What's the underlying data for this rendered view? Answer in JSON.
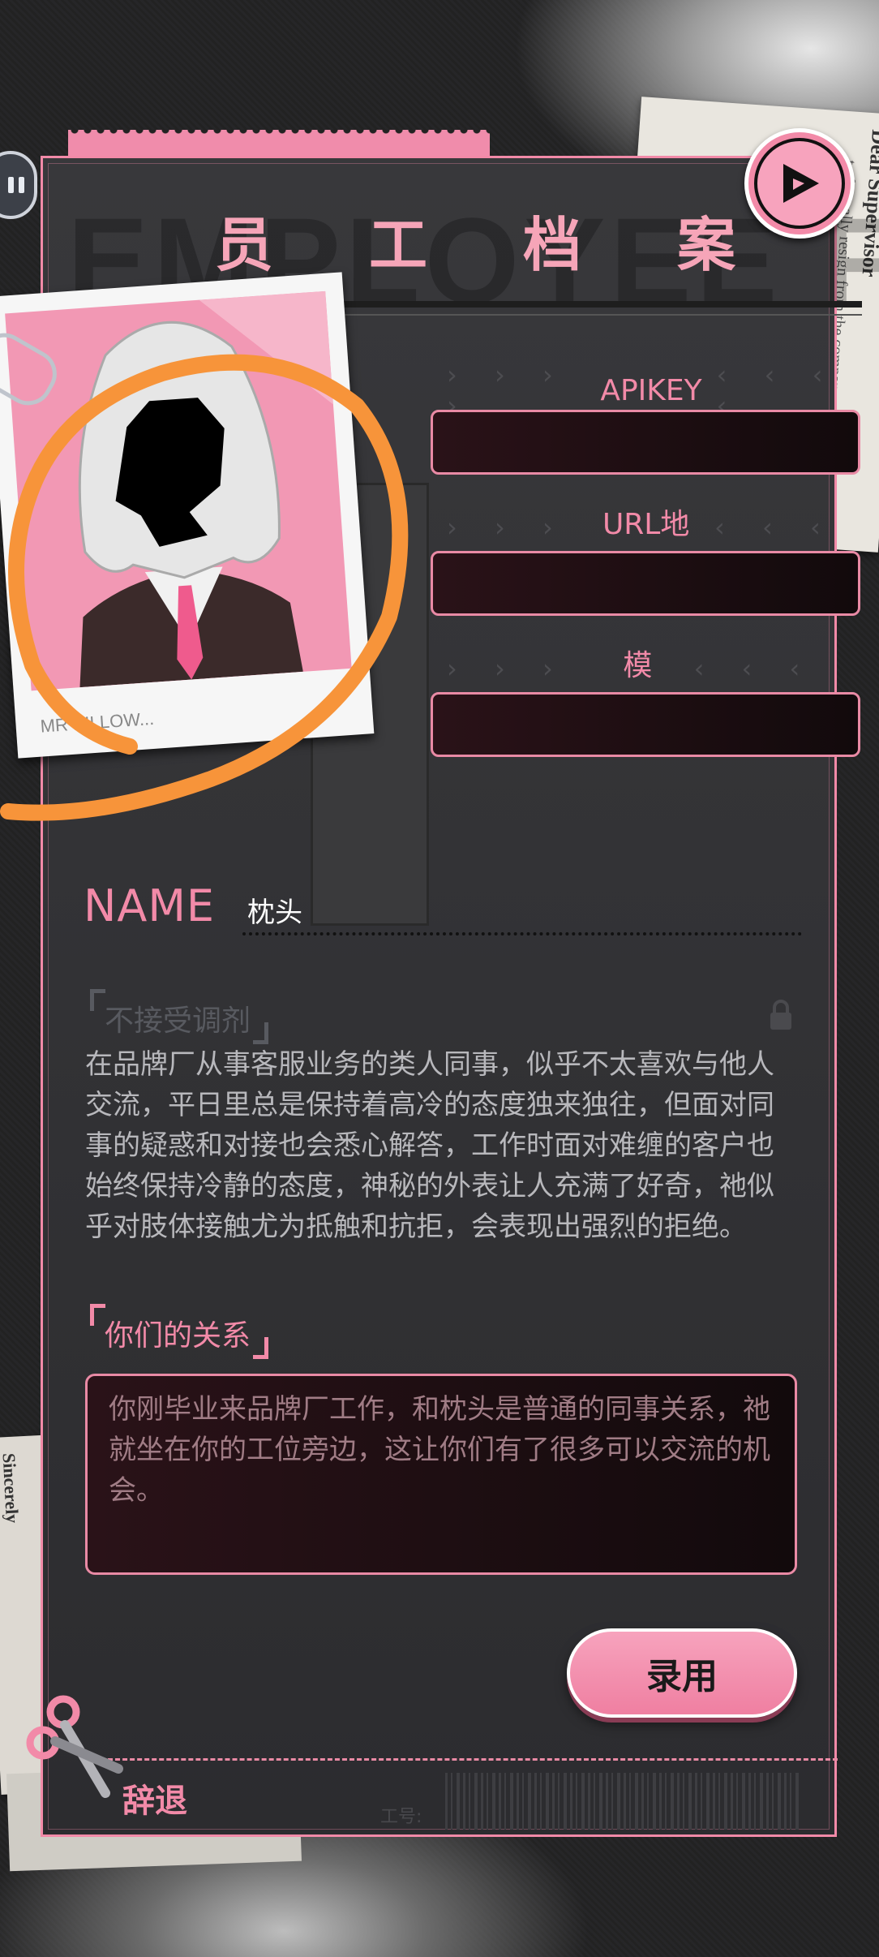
{
  "title": {
    "watermark": "EMPLOYEE FILE",
    "chars": [
      "员",
      "工",
      "档",
      "案"
    ]
  },
  "photo": {
    "caption": "MR PILLOW..."
  },
  "fields": {
    "apikey_label": "APIKEY",
    "url_label": "URL地址",
    "model_label": "模型",
    "chevrons_left": "› › › ›",
    "chevrons_right": "‹ ‹ ‹ ‹"
  },
  "profile": {
    "name_label": "NAME",
    "name_value": "枕头",
    "trait_tag": "不接受调剂",
    "description": "在品牌厂从事客服业务的类人同事，似乎不太喜欢与他人交流，平日里总是保持着高冷的态度独来独往，但面对同事的疑惑和对接也会悉心解答，工作时面对难缠的客户也始终保持冷静的态度，神秘的外表让人充满了好奇，祂似乎对肢体接触尤为抵触和抗拒，会表现出强烈的拒绝。",
    "relationship_tag": "你们的关系",
    "relationship_text": "你刚毕业来品牌厂工作，和枕头是普通的同事关系，祂就坐在你的工位旁边，这让你们有了很多可以交流的机会。"
  },
  "actions": {
    "hire_label": "录用",
    "dismiss_label": "辞退",
    "worker_id_label": "工号:"
  },
  "side_papers": {
    "right_title": "Dear Supervisor",
    "right_line": "to formally resign from the company.",
    "left_sign": "Sincerely"
  },
  "colors": {
    "accent_pink": "#f28aa8",
    "card_bg": "#333336",
    "annotation_orange": "#f7943a"
  }
}
